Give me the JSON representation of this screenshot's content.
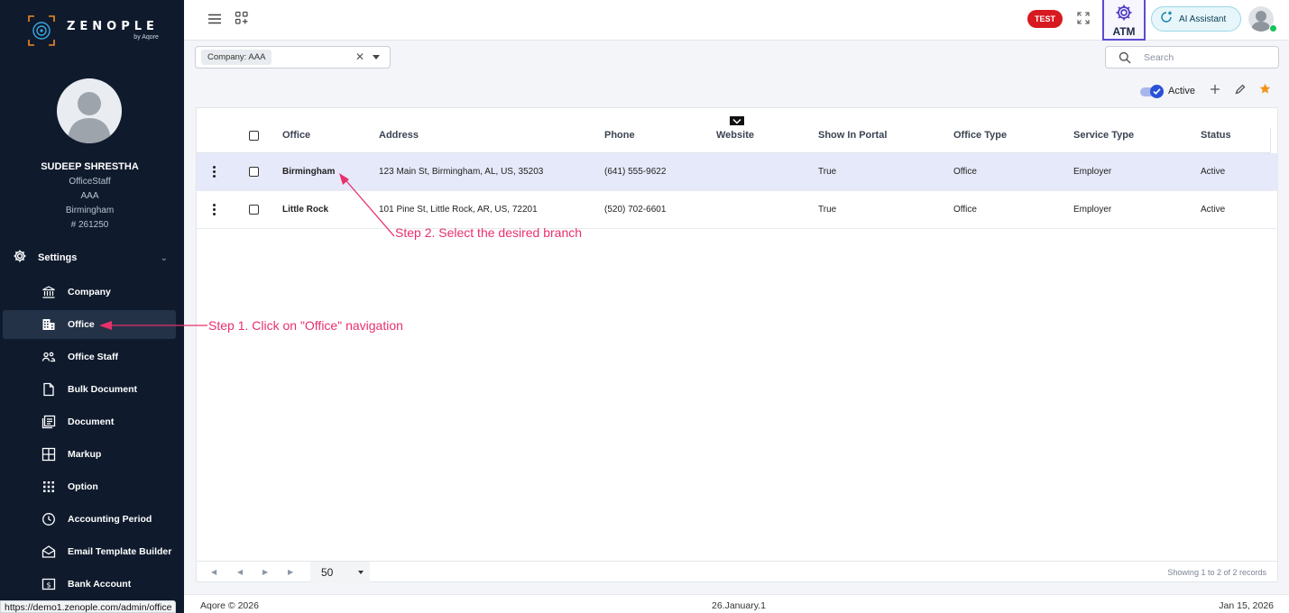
{
  "brand": {
    "name": "ZENOPLE",
    "tagline": "by Aqore"
  },
  "user": {
    "name": "SUDEEP SHRESTHA",
    "role": "OfficeStaff",
    "company": "AAA",
    "office": "Birmingham",
    "id": "# 261250"
  },
  "sidebar": {
    "section_label": "Settings",
    "items": [
      {
        "label": "Company",
        "icon": "bank-icon"
      },
      {
        "label": "Office",
        "icon": "building-icon",
        "active": true
      },
      {
        "label": "Office Staff",
        "icon": "users-icon"
      },
      {
        "label": "Bulk Document",
        "icon": "file-icon"
      },
      {
        "label": "Document",
        "icon": "document-icon"
      },
      {
        "label": "Markup",
        "icon": "grid-icon"
      },
      {
        "label": "Option",
        "icon": "dots-grid-icon"
      },
      {
        "label": "Accounting Period",
        "icon": "clock-icon"
      },
      {
        "label": "Email Template Builder",
        "icon": "mail-icon"
      },
      {
        "label": "Bank Account",
        "icon": "dollar-icon"
      }
    ]
  },
  "status_url": "https://demo1.zenople.com/admin/office",
  "topbar": {
    "env_badge": "TEST",
    "atm_label": "ATM",
    "ai_label": "AI Assistant"
  },
  "filter": {
    "chip_text": "Company: AAA"
  },
  "search": {
    "placeholder": "Search",
    "value": ""
  },
  "toolbar": {
    "toggle_label": "Active",
    "toggle_on": true
  },
  "table": {
    "columns": [
      "Office",
      "Address",
      "Phone",
      "Website",
      "Show In Portal",
      "Office Type",
      "Service Type",
      "Status"
    ],
    "rows": [
      {
        "office": "Birmingham",
        "address": "123 Main St, Birmingham, AL, US, 35203",
        "phone": "(641) 555-9622",
        "website": "",
        "show_in_portal": "True",
        "office_type": "Office",
        "service_type": "Employer",
        "status": "Active",
        "selected": true
      },
      {
        "office": "Little Rock",
        "address": "101 Pine St, Little Rock, AR, US, 72201",
        "phone": "(520) 702-6601",
        "website": "",
        "show_in_portal": "True",
        "office_type": "Office",
        "service_type": "Employer",
        "status": "Active",
        "selected": false
      }
    ]
  },
  "pager": {
    "page_size": "50",
    "info": "Showing 1 to 2 of 2 records"
  },
  "footer": {
    "copyright": "Aqore © 2026",
    "version": "26.January.1",
    "date": "Jan 15, 2026"
  },
  "annotations": {
    "step1": "Step 1. Click on \"Office\" navigation",
    "step2": "Step 2. Select the desired branch"
  },
  "colors": {
    "sidebar_bg": "#0f1b2d",
    "accent": "#2953d6",
    "annotation": "#e8306b",
    "selected_row": "#e6e9f9",
    "test_badge": "#d71920"
  }
}
